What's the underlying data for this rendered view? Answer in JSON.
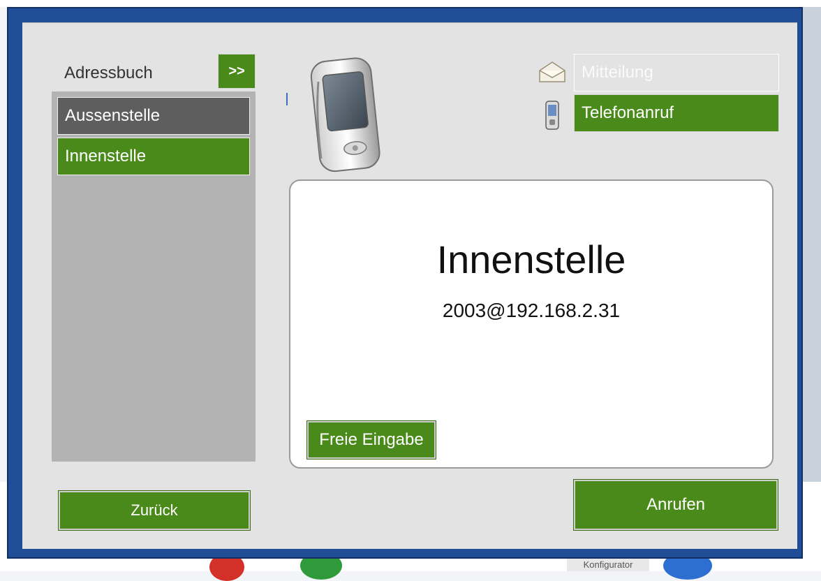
{
  "address_book": {
    "title": "Adressbuch",
    "toggle_label": ">>",
    "items": [
      {
        "label": "Aussenstelle",
        "state": "normal"
      },
      {
        "label": "Innenstelle",
        "state": "selected"
      }
    ]
  },
  "actions": {
    "message_label": "Mitteilung",
    "phone_call_label": "Telefonanruf"
  },
  "contact": {
    "name": "Innenstelle",
    "address": "2003@192.168.2.31"
  },
  "buttons": {
    "free_input": "Freie Eingabe",
    "back": "Zurück",
    "call": "Anrufen"
  },
  "background": {
    "taskbar_label": "Konfigurator"
  },
  "colors": {
    "green": "#4a8a1a",
    "gray_item": "#5e5e5e",
    "list_bg": "#b3b3b3",
    "panel_bg": "#e3e3e3",
    "frame_blue": "#1f4e96"
  },
  "icons": {
    "phone_graphic": "mobile-phone",
    "message": "envelope-icon",
    "phone_call": "phone-icon"
  }
}
